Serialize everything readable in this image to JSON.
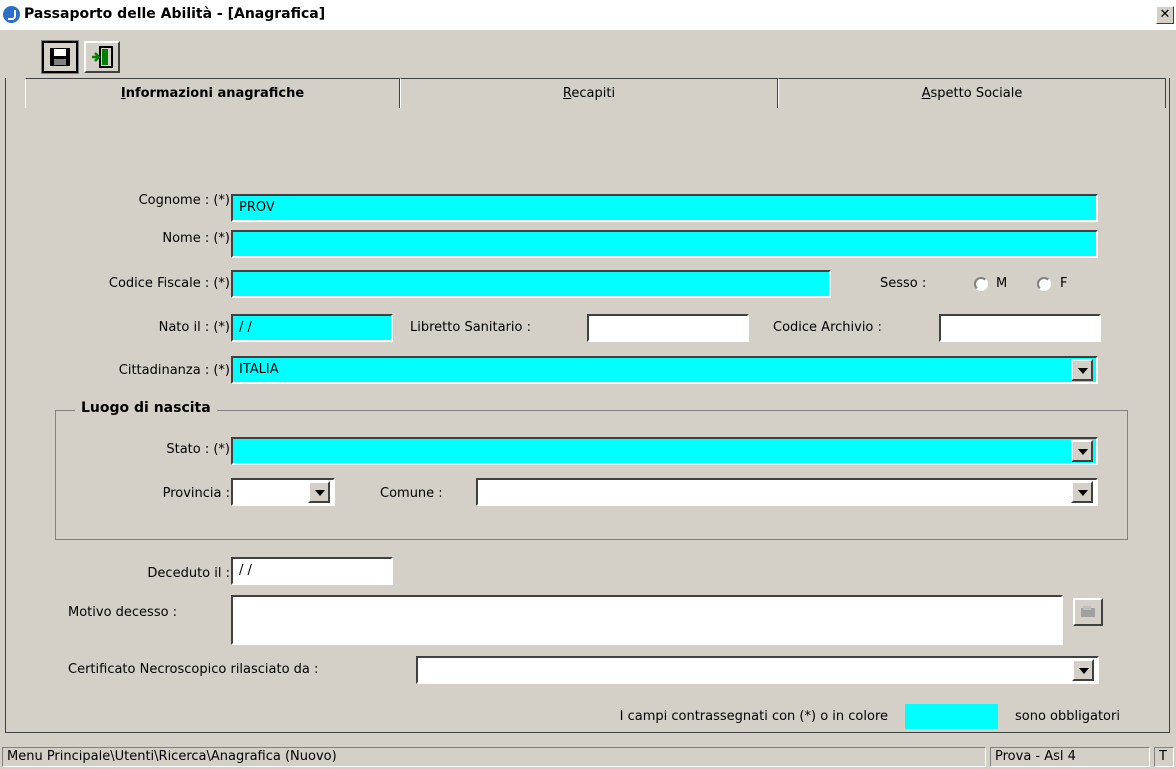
{
  "window": {
    "title": "Passaporto delle Abilità - [Anagrafica]",
    "close_glyph": "✕"
  },
  "toolbar": {
    "save_icon": "floppy-disk-icon",
    "exit_icon": "exit-door-icon"
  },
  "tabs": [
    {
      "accel": "I",
      "rest": "nformazioni anagrafiche",
      "active": true
    },
    {
      "accel": "R",
      "rest": "ecapiti",
      "active": false
    },
    {
      "accel": "A",
      "rest": "spetto Sociale",
      "active": false
    }
  ],
  "form": {
    "cognome_label": "Cognome : (*)",
    "cognome_value": "PROV",
    "nome_label": "Nome : (*)",
    "nome_value": "",
    "codice_fiscale_label": "Codice Fiscale : (*)",
    "codice_fiscale_value": "",
    "sesso_label": "Sesso :",
    "sesso_m": "M",
    "sesso_f": "F",
    "nato_label": "Nato il : (*)",
    "nato_value": " /  /",
    "libretto_label": "Libretto Sanitario :",
    "libretto_value": "",
    "archivio_label": "Codice Archivio :",
    "archivio_value": "",
    "cittadinanza_label": "Cittadinanza : (*)",
    "cittadinanza_value": "ITALIA"
  },
  "luogo": {
    "title": "Luogo di nascita",
    "stato_label": "Stato : (*)",
    "stato_value": "",
    "provincia_label": "Provincia :",
    "provincia_value": "",
    "comune_label": "Comune :",
    "comune_value": ""
  },
  "decesso": {
    "deceduto_label": "Deceduto il :",
    "deceduto_value": " /  /",
    "motivo_label": "Motivo decesso :",
    "motivo_value": "",
    "certificato_label": "Certificato Necroscopico rilasciato da  :",
    "certificato_value": ""
  },
  "legend": {
    "text_before": "I campi contrassegnati con (*) o in colore",
    "text_after": "sono obbligatori",
    "required_color": "#00ffff"
  },
  "statusbar": {
    "path": "Menu Principale\\Utenti\\Ricerca\\Anagrafica (Nuovo)",
    "user": "Prova - Asl 4",
    "extra": "T"
  }
}
